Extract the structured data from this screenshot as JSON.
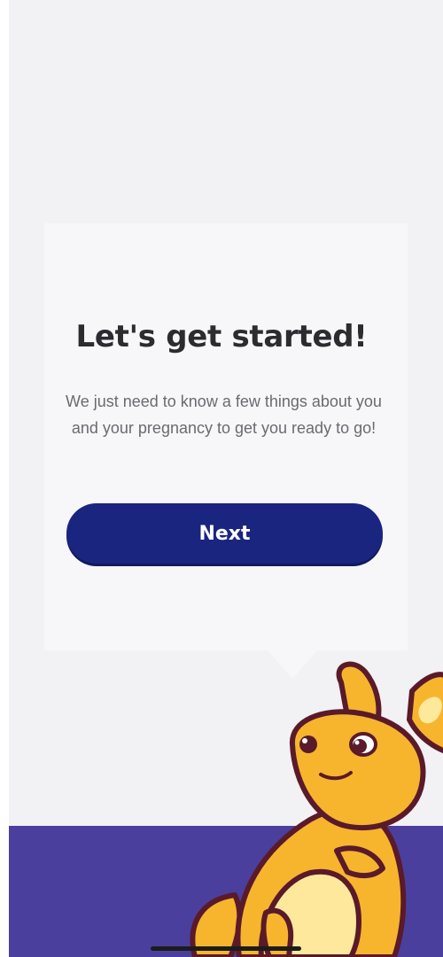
{
  "onboarding": {
    "title": "Let's get started!",
    "subtitle": "We just need to know a few things about you and your pregnancy to get you ready to go!",
    "next_label": "Next"
  },
  "mascot": {
    "icon": "kangaroo-mascot-icon"
  },
  "colors": {
    "background": "#f2f1f4",
    "card": "#f7f6f9",
    "button": "#1a2580",
    "bottom_band": "#4b3f9e",
    "mascot_body": "#f6b52d",
    "mascot_outline": "#5a1a2a"
  }
}
